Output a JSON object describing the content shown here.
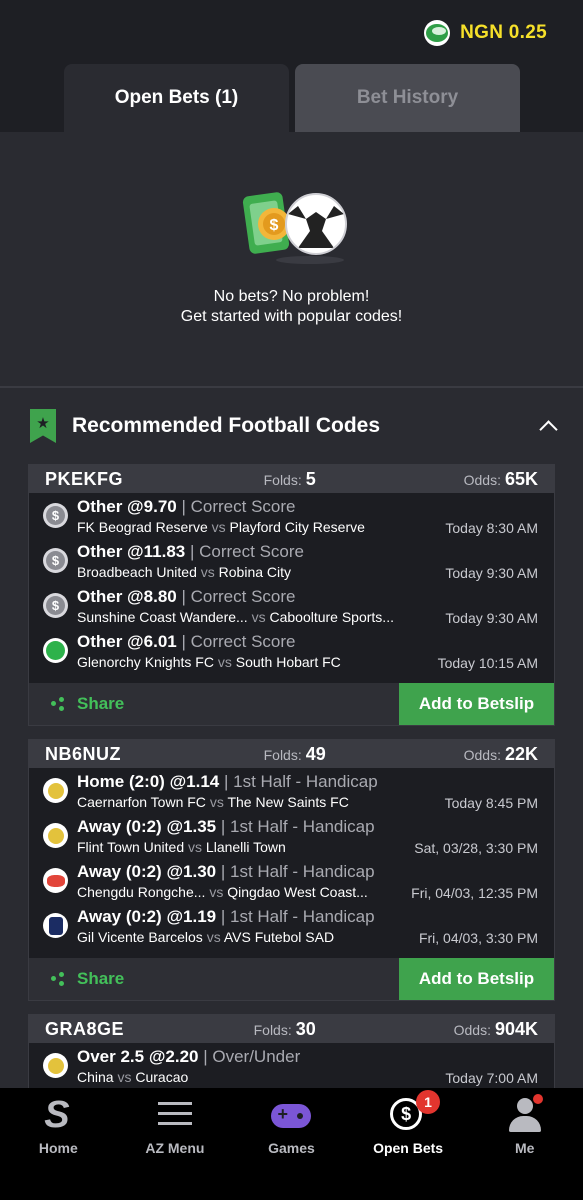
{
  "header": {
    "balance": "NGN 0.25",
    "coin_icon": "ngn-coin-icon"
  },
  "tabs": [
    {
      "label": "Open Bets (1)",
      "active": true
    },
    {
      "label": "Bet History",
      "active": false
    }
  ],
  "empty_state": {
    "line1": "No bets? No problem!",
    "line2": "Get started with popular codes!"
  },
  "recommended": {
    "title": "Recommended Football Codes",
    "accent": "#3fa34d",
    "cards": [
      {
        "code": "PKEKFG",
        "folds_label": "Folds:",
        "folds": "5",
        "odds_label": "Odds:",
        "odds": "65K",
        "selections": [
          {
            "pick": "Other @9.70",
            "market": "| Correct Score",
            "home": "FK Beograd Reserve",
            "vs": "vs",
            "away": "Playford City Reserve",
            "time": "Today 8:30 AM",
            "icon": "gray"
          },
          {
            "pick": "Other @11.83",
            "market": "| Correct Score",
            "home": "Broadbeach United",
            "vs": "vs",
            "away": "Robina City",
            "time": "Today 9:30 AM",
            "icon": "gray"
          },
          {
            "pick": "Other @8.80",
            "market": "| Correct Score",
            "home": "Sunshine Coast Wandere...",
            "vs": "vs",
            "away": "Caboolture Sports...",
            "time": "Today 9:30 AM",
            "icon": "gray"
          },
          {
            "pick": "Other @6.01",
            "market": "| Correct Score",
            "home": "Glenorchy Knights FC",
            "vs": "vs",
            "away": "South Hobart FC",
            "time": "Today 10:15 AM",
            "icon": "green"
          }
        ],
        "share_label": "Share",
        "add_label": "Add to Betslip"
      },
      {
        "code": "NB6NUZ",
        "folds_label": "Folds:",
        "folds": "49",
        "odds_label": "Odds:",
        "odds": "22K",
        "selections": [
          {
            "pick": "Home (2:0) @1.14",
            "market": "| 1st Half - Handicap",
            "home": "Caernarfon Town FC",
            "vs": "vs",
            "away": "The New Saints FC",
            "time": "Today 8:45 PM",
            "icon": "crest"
          },
          {
            "pick": "Away (0:2) @1.35",
            "market": "| 1st Half - Handicap",
            "home": "Flint Town United",
            "vs": "vs",
            "away": "Llanelli Town",
            "time": "Sat, 03/28, 3:30 PM",
            "icon": "crest"
          },
          {
            "pick": "Away (0:2) @1.30",
            "market": "| 1st Half - Handicap",
            "home": "Chengdu Rongche...",
            "vs": "vs",
            "away": "Qingdao West Coast...",
            "time": "Fri, 04/03, 12:35 PM",
            "icon": "crest2"
          },
          {
            "pick": "Away (0:2) @1.19",
            "market": "| 1st Half - Handicap",
            "home": "Gil Vicente Barcelos",
            "vs": "vs",
            "away": "AVS Futebol SAD",
            "time": "Fri, 04/03, 3:30 PM",
            "icon": "crest3"
          }
        ],
        "share_label": "Share",
        "add_label": "Add to Betslip"
      },
      {
        "code": "GRA8GE",
        "folds_label": "Folds:",
        "folds": "30",
        "odds_label": "Odds:",
        "odds": "904K",
        "selections": [
          {
            "pick": "Over 2.5 @2.20",
            "market": "| Over/Under",
            "home": "China",
            "vs": "vs",
            "away": "Curacao",
            "time": "Today 7:00 AM",
            "icon": "crest"
          }
        ]
      }
    ]
  },
  "nav": [
    {
      "label": "Home",
      "icon": "home-logo-icon"
    },
    {
      "label": "AZ Menu",
      "icon": "menu-icon"
    },
    {
      "label": "Games",
      "icon": "gamepad-icon"
    },
    {
      "label": "Open Bets",
      "icon": "open-bets-icon",
      "badge": "1",
      "active": true
    },
    {
      "label": "Me",
      "icon": "user-icon"
    }
  ]
}
